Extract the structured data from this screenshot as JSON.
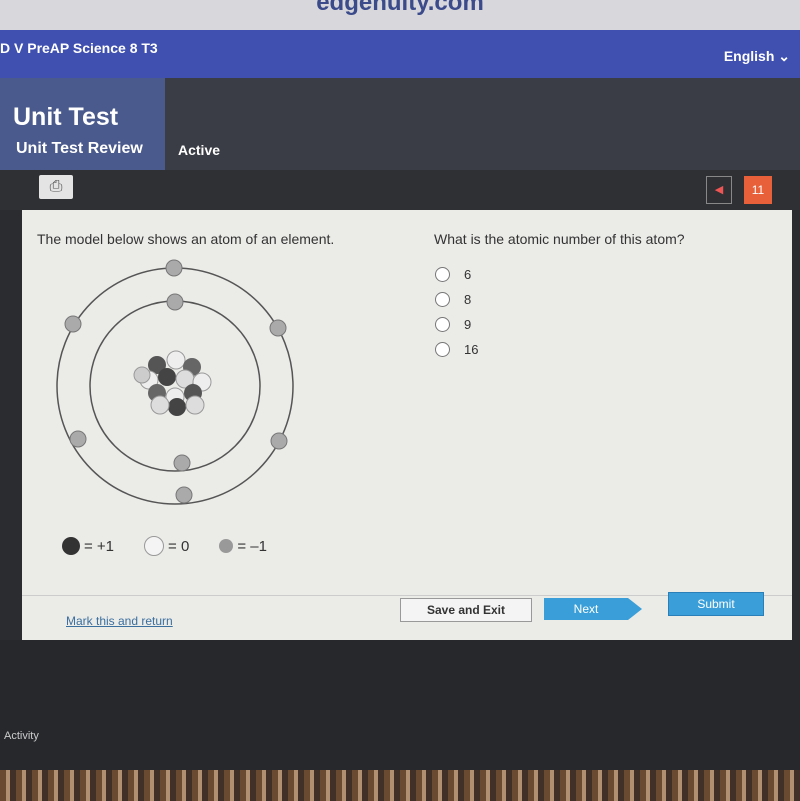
{
  "browser": {
    "url": "edgenuity.com"
  },
  "topbar": {
    "course": "D V PreAP Science 8 T3",
    "language": "English"
  },
  "header": {
    "title": "Unit Test",
    "subtitle": "Unit Test Review",
    "status": "Active"
  },
  "toolbar": {
    "page": "11"
  },
  "question": {
    "prompt": "The model below shows an atom of an element.",
    "question": "What is the atomic number of this atom?",
    "options": [
      "6",
      "8",
      "9",
      "16"
    ]
  },
  "legend": [
    {
      "label": "= +1",
      "color": "#333333"
    },
    {
      "label": "= 0",
      "color": "#f4f4f4"
    },
    {
      "label": "= –1",
      "color": "#999999"
    }
  ],
  "footer": {
    "mark": "Mark this and return",
    "save": "Save and Exit",
    "next": "Next",
    "submit": "Submit"
  },
  "bottom": {
    "activity": "Activity"
  }
}
